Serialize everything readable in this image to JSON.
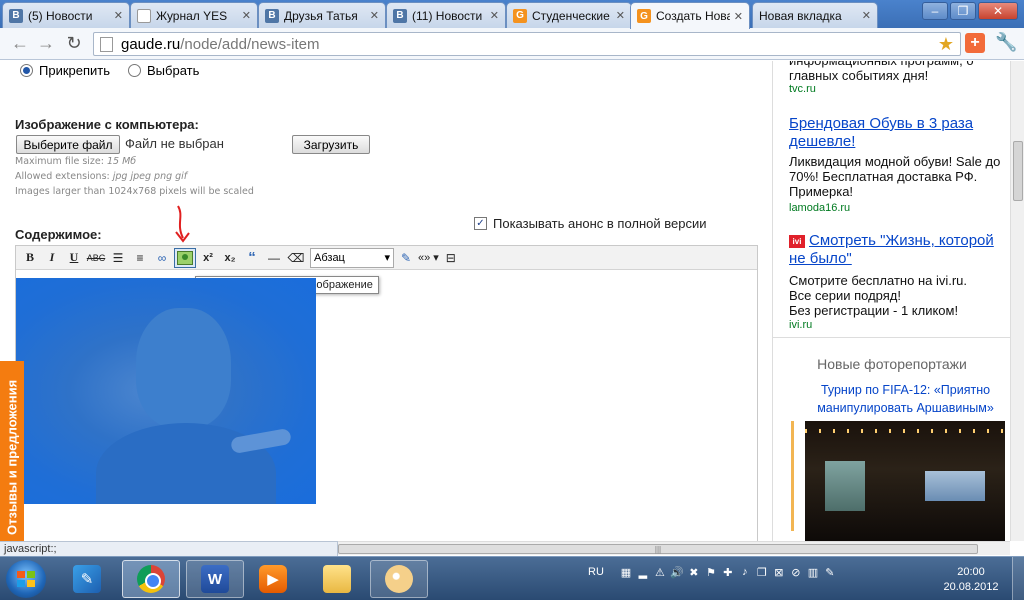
{
  "browser": {
    "tabs": [
      {
        "label": "(5) Новости",
        "icon": "vk-icon"
      },
      {
        "label": "Журнал YES",
        "icon": "document-icon"
      },
      {
        "label": "Друзья Татья",
        "icon": "vk-icon"
      },
      {
        "label": "(11) Новости",
        "icon": "vk-icon"
      },
      {
        "label": "Студенческие",
        "icon": "gaude-icon"
      },
      {
        "label": "Создать Нова",
        "icon": "gaude-icon"
      },
      {
        "label": "Новая вкладка",
        "icon": ""
      }
    ],
    "address": {
      "host": "gaude.ru",
      "path": "/node/add/news-item"
    },
    "status": "javascript:;"
  },
  "form": {
    "radio_attach": "Прикрепить",
    "radio_select": "Выбрать",
    "image_section_label": "Изображение с компьютера:",
    "choose_file_button": "Выберите файл",
    "no_file_text": "Файл не выбран",
    "upload_button": "Загрузить",
    "hint_max_size_label": "Maximum file size:",
    "hint_max_size_value": "15 Мб",
    "hint_ext_label": "Allowed extensions:",
    "hint_ext_value": "jpg jpeg png gif",
    "hint_scale": "Images larger than 1024x768 pixels will be scaled",
    "show_teaser_label": "Показывать анонс в полной версии",
    "content_label": "Содержимое:"
  },
  "editor": {
    "buttons": {
      "bold": "B",
      "italic": "I",
      "underline": "U",
      "strike": "ABC",
      "sup": "x²",
      "sub": "x₂",
      "quote": "“"
    },
    "format_select": "Абзац",
    "tooltip": "Добавить/Изменить изображение"
  },
  "feedback_tab": "Отзывы и предложения",
  "sidebar": {
    "ad1_text": "информационных программ, о главных событиях дня!",
    "ad1_src": "tvc.ru",
    "ad2_title": "Брендовая Обувь в 3 раза дешевле!",
    "ad2_text": "Ликвидация модной обуви! Sale до 70%! Бесплатная доставка РФ. Примерка!",
    "ad2_src": "lamoda16.ru",
    "ad3_badge": "ivi",
    "ad3_title": "Смотреть \"Жизнь, которой не было\"",
    "ad3_text1": "Смотрите бесплатно на ivi.ru.",
    "ad3_text2": "Все серии подряд!",
    "ad3_text3": "Без регистрации - 1 кликом!",
    "ad3_src": "ivi.ru",
    "photo_heading": "Новые фоторепортажи",
    "photo_link": "Турнир по FIFA-12: «Приятно манипулировать Аршавиным»"
  },
  "taskbar": {
    "lang": "RU",
    "time": "20:00",
    "date": "20.08.2012"
  },
  "colors": {
    "feedback_tab": "#f47c10",
    "link": "#0645c9",
    "ad_source": "#007a20",
    "editor_image_overlay": "#1a6ddc"
  }
}
